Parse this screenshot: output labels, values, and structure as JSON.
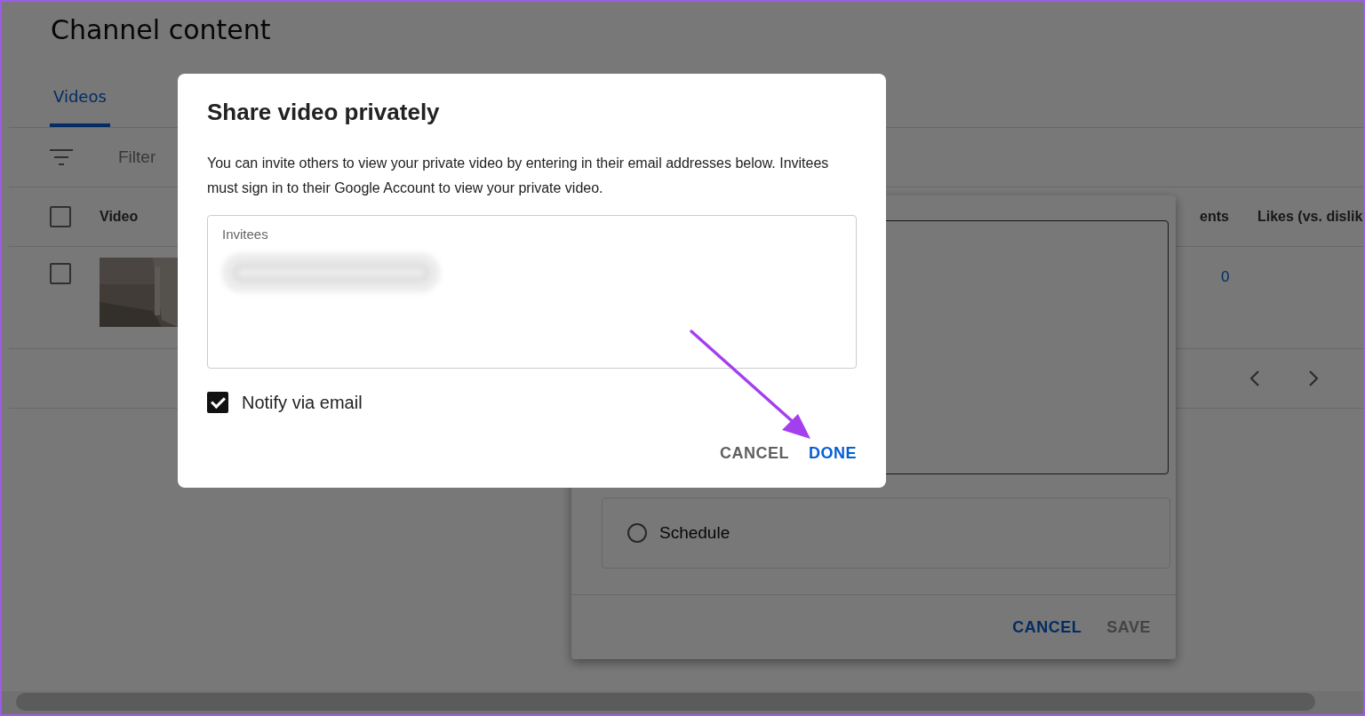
{
  "page": {
    "title": "Channel content",
    "tabs": [
      {
        "label": "Videos",
        "selected": true
      }
    ],
    "filter": {
      "placeholder": "Filter"
    },
    "table": {
      "header_checked": false,
      "columns": [
        {
          "label": "Video"
        },
        {
          "label": "ents"
        },
        {
          "label": "Likes (vs. dislik"
        }
      ],
      "rows": [
        {
          "checked": false,
          "column_2": "0"
        }
      ]
    }
  },
  "visibility_dialog": {
    "options": [
      {
        "label": "Schedule",
        "selected": false
      }
    ],
    "buttons": [
      {
        "label": "CANCEL",
        "disabled": false
      },
      {
        "label": "SAVE",
        "disabled": true
      }
    ]
  },
  "share_dialog": {
    "title": "Share video privately",
    "description": "You can invite others to view your private video by entering in their email addresses below. Invitees must sign in to their Google Account to view your private video.",
    "invitees": {
      "label": "Invitees",
      "chips": [
        {
          "kind": "blurred"
        }
      ]
    },
    "notify": {
      "label": "Notify via email",
      "checked": true
    },
    "buttons": [
      {
        "label": "CANCEL",
        "primary": false
      },
      {
        "label": "DONE",
        "primary": true
      }
    ]
  },
  "annotation": {
    "kind": "arrow"
  }
}
